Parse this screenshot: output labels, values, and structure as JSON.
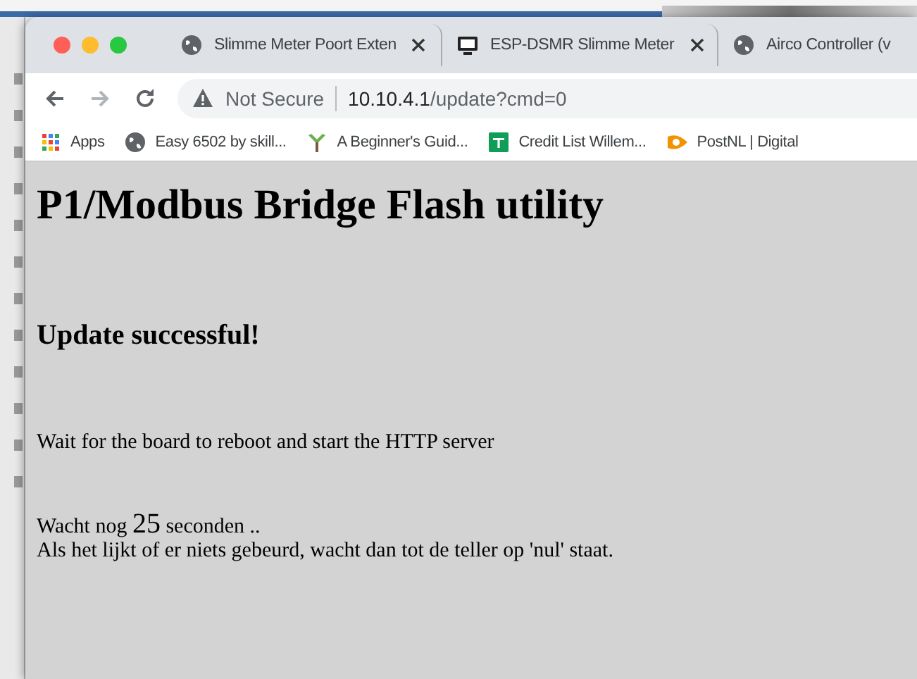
{
  "tabs": [
    {
      "title": "Slimme Meter Poort Exten",
      "selected": false
    },
    {
      "title": "ESP-DSMR Slimme Meter",
      "selected": false
    },
    {
      "title": "Airco Controller (v",
      "selected": false
    }
  ],
  "toolbar": {
    "back_disabled": false,
    "forward_disabled": true,
    "security": "Not Secure",
    "url_host": "10.10.4.1",
    "url_path": "/update?cmd=0"
  },
  "bookmarks": [
    {
      "label": "Apps"
    },
    {
      "label": "Easy 6502 by skill..."
    },
    {
      "label": "A Beginner's Guid..."
    },
    {
      "label": "Credit List Willem..."
    },
    {
      "label": "PostNL | Digital"
    }
  ],
  "page": {
    "title": "P1/Modbus Bridge Flash utility",
    "status": "Update successful!",
    "message": "Wait for the board to reboot and start the HTTP server",
    "wait_prefix": "Wacht nog",
    "countdown": "25",
    "wait_suffix": "seconden ..",
    "hint": "Als het lijkt of er niets gebeurd, wacht dan tot de teller op 'nul' staat."
  }
}
